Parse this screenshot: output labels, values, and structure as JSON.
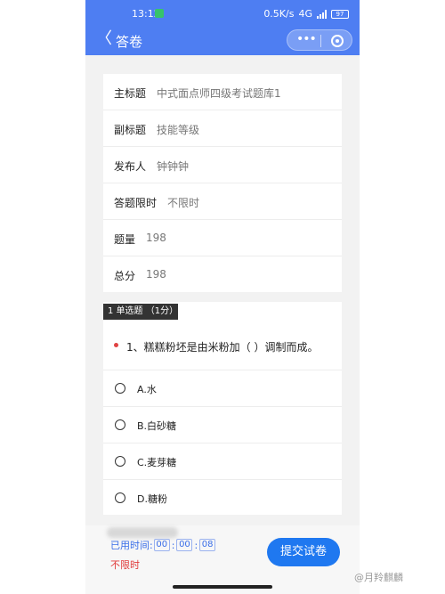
{
  "status_bar": {
    "time": "13:12",
    "speed": "0.5K/s",
    "network": "4G",
    "battery": "97"
  },
  "nav": {
    "back": "〈",
    "title": "答卷"
  },
  "info": [
    {
      "label": "主标题",
      "value": "中式面点师四级考试题库1"
    },
    {
      "label": "副标题",
      "value": "技能等级"
    },
    {
      "label": "发布人",
      "value": "钟钟钟"
    },
    {
      "label": "答题限时",
      "value": "不限时"
    },
    {
      "label": "题量",
      "value": "198"
    },
    {
      "label": "总分",
      "value": "198"
    }
  ],
  "question": {
    "tag": "1 单选题 （1分）",
    "text": "1、糕糕粉坯是由米粉加（ ）调制而成。",
    "options": [
      "A.水",
      "B.白砂糖",
      "C.麦芽糖",
      "D.糖粉"
    ]
  },
  "footer": {
    "used_label": "已用时间:",
    "hh": "00",
    "mm": "00",
    "ss": "08",
    "limit": "不限时",
    "submit": "提交试卷"
  },
  "watermark": "@月羚麒麟",
  "colors": {
    "header": "#4e7ef2",
    "primary": "#1f78f0",
    "warning": "#e03b3b"
  }
}
